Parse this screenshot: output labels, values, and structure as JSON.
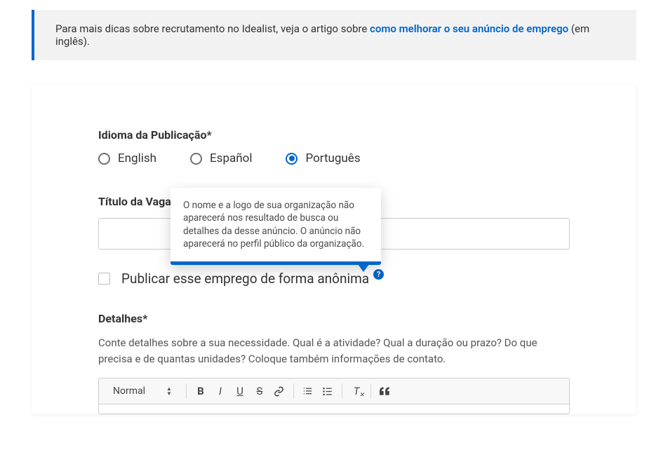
{
  "banner": {
    "pre": "Para mais dicas sobre recrutamento no Idealist, veja o artigo sobre ",
    "link": "como melhorar o seu anúncio de emprego",
    "post": " (em inglês)."
  },
  "lang": {
    "label": "Idioma da Publicação*",
    "options": {
      "en": "English",
      "es": "Español",
      "pt": "Português"
    }
  },
  "title": {
    "label": "Título da Vaga*",
    "value": ""
  },
  "anon": {
    "label": "Publicar esse emprego de forma anônima",
    "help_icon": "?",
    "tooltip": "O nome e a logo de sua organização não aparecerá nos resultado de busca ou detalhes da desse anúncio. O anúncio não aparecerá no perfil público da organização."
  },
  "details": {
    "label": "Detalhes*",
    "help": "Conte detalhes sobre a sua necessidade. Qual é a atividade? Qual a duração ou prazo? Do que precisa e de quantas unidades? Coloque também informações de contato."
  },
  "toolbar": {
    "style_select": "Normal"
  }
}
